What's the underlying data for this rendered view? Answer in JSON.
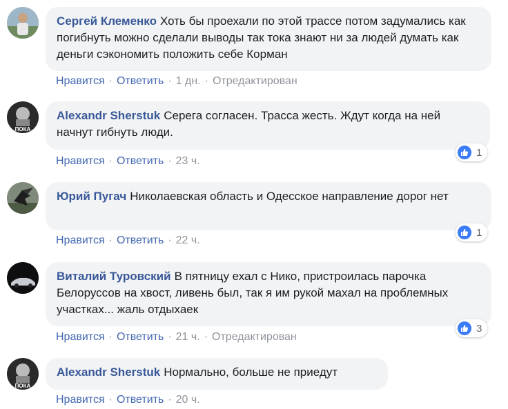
{
  "actions": {
    "like": "Нравится",
    "reply": "Ответить",
    "separator": "·"
  },
  "comments": [
    {
      "author": "Сергей Клеменко",
      "text": "Хоть бы проехали по этой трассе потом задумались как погибнуть можно сделали выводы так тока знают ни за людей думать как деньги сэкономить положить себе Корман",
      "time": "1 дн.",
      "edited": "Отредактирован",
      "avatar": "avatar-photo-man"
    },
    {
      "author": "Alexandr Sherstuk",
      "text": "Серега согласен. Трасса жесть. Ждут когда на ней начнут гибнуть люди.",
      "time": "23 ч.",
      "reactions": "1",
      "reaction_icon": "like-icon",
      "avatar_caption": "ПОКА",
      "avatar": "avatar-photo-bw"
    },
    {
      "author": "Юрий Пугач",
      "text": "Николаевская область и Одесское направление дорог нет",
      "time": "22 ч.",
      "reactions": "1",
      "reaction_icon": "like-icon",
      "avatar": "avatar-photo-bird"
    },
    {
      "author": "Виталий Туровский",
      "text": "В пятницу ехал с Нико, пристроилась парочка Белоруссов на хвост, ливень был, так я им рукой махал на проблемных участках... жаль отдыхаек",
      "time": "21 ч.",
      "edited": "Отредактирован",
      "reactions": "3",
      "reaction_icon": "like-icon",
      "avatar": "avatar-photo-car"
    },
    {
      "author": "Alexandr Sherstuk",
      "text": "Нормально, больше не приедут",
      "time": "20 ч.",
      "avatar_caption": "ПОКА",
      "avatar": "avatar-photo-bw"
    }
  ]
}
